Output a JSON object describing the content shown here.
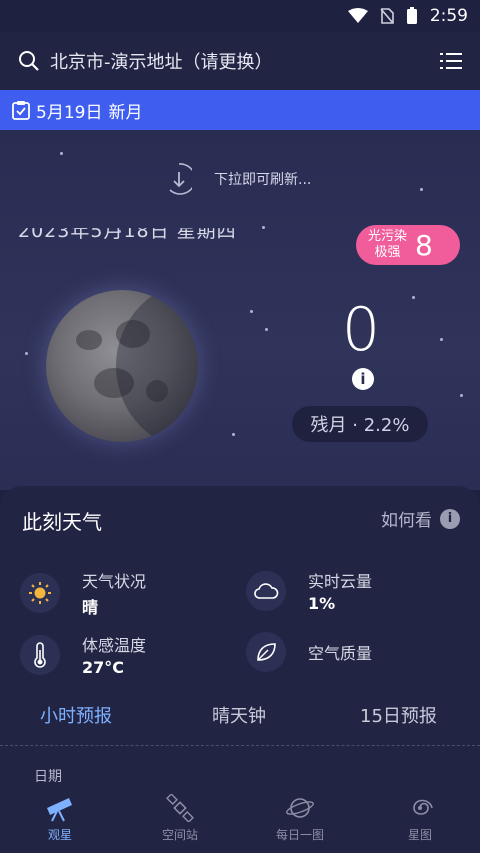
{
  "status_bar": {
    "time": "2:59"
  },
  "search": {
    "location": "北京市-演示地址（请更换）"
  },
  "banner": {
    "date": "5月19日",
    "phase": "新月"
  },
  "sky": {
    "refresh_hint": "下拉即可刷新...",
    "ghost_date": "2023年5月18日 星期四",
    "pollution_label_1": "光污染",
    "pollution_label_2": "极强",
    "pollution_level": "8",
    "big_value": "0",
    "phase": "残月 · 2.2%"
  },
  "weather": {
    "title": "此刻天气",
    "how_to": "如何看",
    "condition_label": "天气状况",
    "condition_value": "晴",
    "cloud_label": "实时云量",
    "cloud_value": "1%",
    "feels_label": "体感温度",
    "feels_value": "27°C",
    "air_label": "空气质量"
  },
  "tabs": [
    {
      "label": "小时预报"
    },
    {
      "label": "晴天钟"
    },
    {
      "label": "15日预报"
    }
  ],
  "date_header": "日期",
  "nav": [
    {
      "label": "观星"
    },
    {
      "label": "空间站"
    },
    {
      "label": "每日一图"
    },
    {
      "label": "星图"
    }
  ],
  "colors": {
    "accent": "#3f5ef0",
    "pollution": "#f05d9a",
    "active": "#7eb1ff"
  }
}
